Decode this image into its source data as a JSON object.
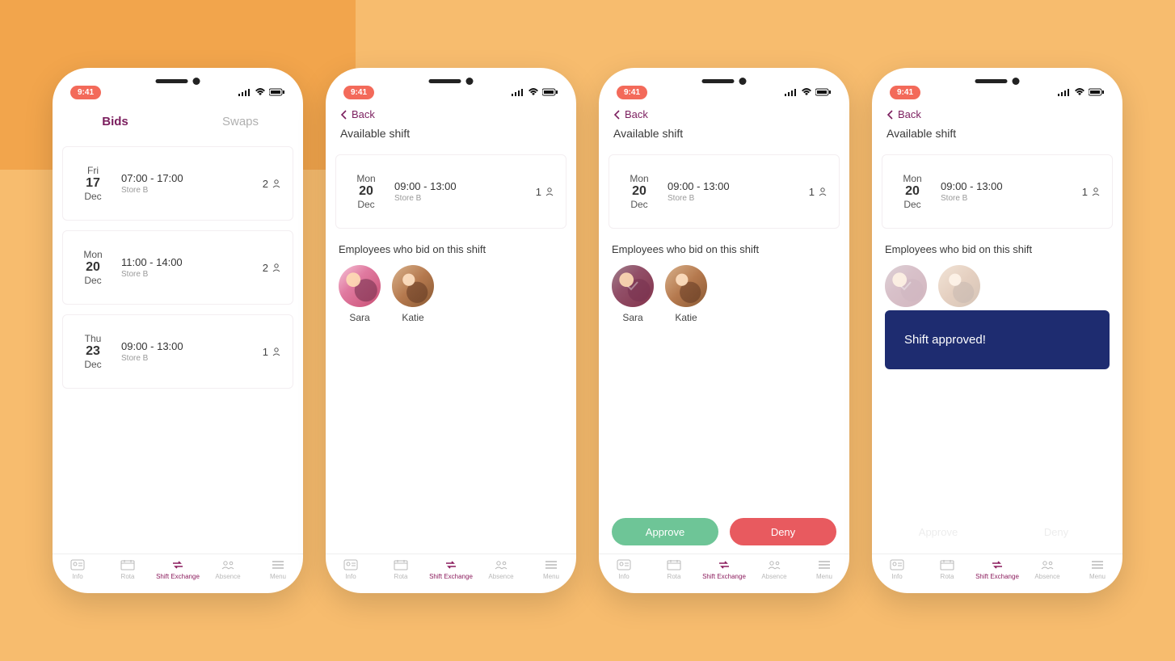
{
  "status": {
    "time": "9:41"
  },
  "nav": {
    "back_label": "Back"
  },
  "screens": {
    "list": {
      "tabs": {
        "bids": "Bids",
        "swaps": "Swaps"
      },
      "cards": [
        {
          "dow": "Fri",
          "day": "17",
          "mon": "Dec",
          "time": "07:00 - 17:00",
          "loc": "Store B",
          "count": "2"
        },
        {
          "dow": "Mon",
          "day": "20",
          "mon": "Dec",
          "time": "11:00 - 14:00",
          "loc": "Store B",
          "count": "2"
        },
        {
          "dow": "Thu",
          "day": "23",
          "mon": "Dec",
          "time": "09:00 - 13:00",
          "loc": "Store B",
          "count": "1"
        }
      ]
    },
    "detail": {
      "title": "Available shift",
      "card": {
        "dow": "Mon",
        "day": "20",
        "mon": "Dec",
        "time": "09:00 - 13:00",
        "loc": "Store B",
        "count": "1"
      },
      "emp_title": "Employees who bid on this shift",
      "employees": [
        {
          "name": "Sara"
        },
        {
          "name": "Katie"
        }
      ]
    },
    "actions": {
      "approve": "Approve",
      "deny": "Deny"
    },
    "toast": "Shift approved!"
  },
  "bottom_tabs": {
    "info": "Info",
    "rota": "Rota",
    "shift_exchange": "Shift Exchange",
    "absence": "Absence",
    "menu": "Menu"
  }
}
